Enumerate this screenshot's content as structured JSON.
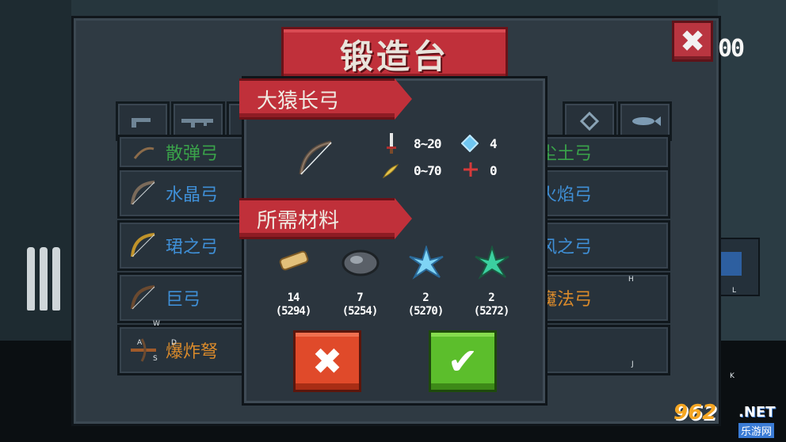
{
  "title": "锻造台",
  "close_label": "✖",
  "coin_count": "00",
  "tabs": [
    "",
    "",
    "",
    "",
    ""
  ],
  "weapons_left": [
    {
      "name": "散弹弓",
      "color": "#3aa34a"
    },
    {
      "name": "水晶弓",
      "color": "#3f8fd6"
    },
    {
      "name": "珺之弓",
      "color": "#3f8fd6"
    },
    {
      "name": "巨弓",
      "color": "#3f8fd6"
    },
    {
      "name": "爆炸弩",
      "color": "#d98a2b"
    }
  ],
  "weapons_right": [
    {
      "name": "尘土弓",
      "color": "#3aa34a"
    },
    {
      "name": "火焰弓",
      "color": "#3f8fd6"
    },
    {
      "name": "风之弓",
      "color": "#3f8fd6"
    },
    {
      "name": "魔法弓",
      "color": "#d98a2b"
    },
    {
      "name": "",
      "color": "#3f8fd6"
    }
  ],
  "dialog": {
    "item_name": "大猿长弓",
    "stats": {
      "damage": "8~20",
      "energy": "4",
      "crit": "0~70",
      "accuracy": "0"
    },
    "materials_title": "所需材料",
    "materials": [
      {
        "icon": "wood-log",
        "need": "14",
        "have": "(5294)"
      },
      {
        "icon": "stone-ore",
        "need": "7",
        "have": "(5254)"
      },
      {
        "icon": "blue-crystal",
        "need": "2",
        "have": "(5270)"
      },
      {
        "icon": "green-crystal",
        "need": "2",
        "have": "(5272)"
      }
    ],
    "cancel_label": "✖",
    "confirm_label": "✔"
  },
  "key_hints": [
    "W",
    "A",
    "D",
    "S",
    "H",
    "L",
    "J",
    "K"
  ],
  "watermark": {
    "number": "962",
    "net": ".NET",
    "cn": "乐游网"
  },
  "colors": {
    "banner": "#c0303a",
    "panel": "#2f3a43",
    "cancel": "#e04a2a",
    "confirm": "#5cbe2c"
  }
}
